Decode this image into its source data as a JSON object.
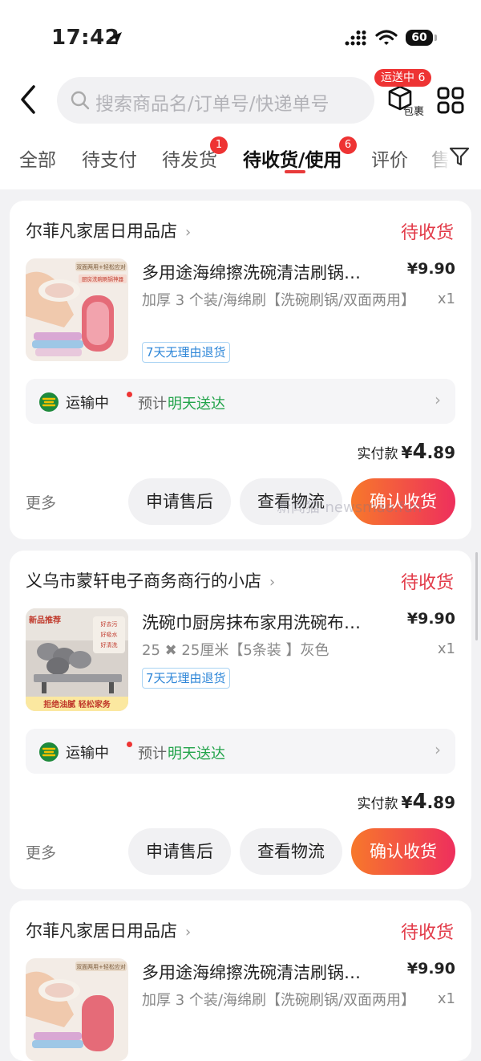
{
  "status_bar": {
    "time": "17:42",
    "battery": "60"
  },
  "header": {
    "search_placeholder": "搜索商品名/订单号/快递单号",
    "package_label": "包裹",
    "shipping_badge": "运送中 6"
  },
  "tabs": [
    {
      "label": "全部"
    },
    {
      "label": "待支付"
    },
    {
      "label": "待发货",
      "badge": "1"
    },
    {
      "label": "待收货/使用",
      "badge": "6",
      "active": true
    },
    {
      "label": "评价"
    },
    {
      "label": "售"
    }
  ],
  "orders": [
    {
      "store": "尔菲凡家居日用品店",
      "status": "待收货",
      "title": "多用途海绵擦洗碗清洁刷锅…",
      "price": "¥9.90",
      "spec": "加厚 3 个装/海绵刷【洗碗刷锅/双面两用】",
      "qty": "x1",
      "return_badge": "7天无理由退货",
      "logistics_status": "运输中",
      "logistics_estimate": "预计",
      "logistics_time": "明天送达",
      "paid_label": "实付款",
      "paid_symbol": "¥",
      "paid_int": "4",
      "paid_dec": ".89",
      "more": "更多",
      "btn_after_sale": "申请售后",
      "btn_logistics": "查看物流",
      "btn_confirm": "确认收货"
    },
    {
      "store": "义乌市蒙轩电子商务商行的小店",
      "status": "待收货",
      "title": "洗碗巾厨房抹布家用洗碗布…",
      "price": "¥9.90",
      "spec": "25 ✖ 25厘米【5条装 】灰色",
      "qty": "x1",
      "return_badge": "7天无理由退货",
      "logistics_status": "运输中",
      "logistics_estimate": "预计",
      "logistics_time": "明天送达",
      "paid_label": "实付款",
      "paid_symbol": "¥",
      "paid_int": "4",
      "paid_dec": ".89",
      "more": "更多",
      "btn_after_sale": "申请售后",
      "btn_logistics": "查看物流",
      "btn_confirm": "确认收货"
    },
    {
      "store": "尔菲凡家居日用品店",
      "status": "待收货",
      "title": "多用途海绵擦洗碗清洁刷锅…",
      "price": "¥9.90",
      "spec": "加厚 3 个装/海绵刷【洗碗刷锅/双面两用】",
      "qty": "x1"
    }
  ],
  "thumb_texts": {
    "sponge_top": "双面两用+轻松应对",
    "sponge_sub": "厨房洗碗刷锅神器",
    "towel_tag": "新品推荐",
    "towel_bottom": "拒绝油腻 轻松家务",
    "towel_f1": "好去污",
    "towel_f2": "好吸水",
    "towel_f3": "好清洗"
  },
  "watermark": "新闻猫-newsmao.fun",
  "colors": {
    "accent_red": "#e23a48",
    "green": "#22a34a",
    "badge_red": "#ee3333"
  }
}
